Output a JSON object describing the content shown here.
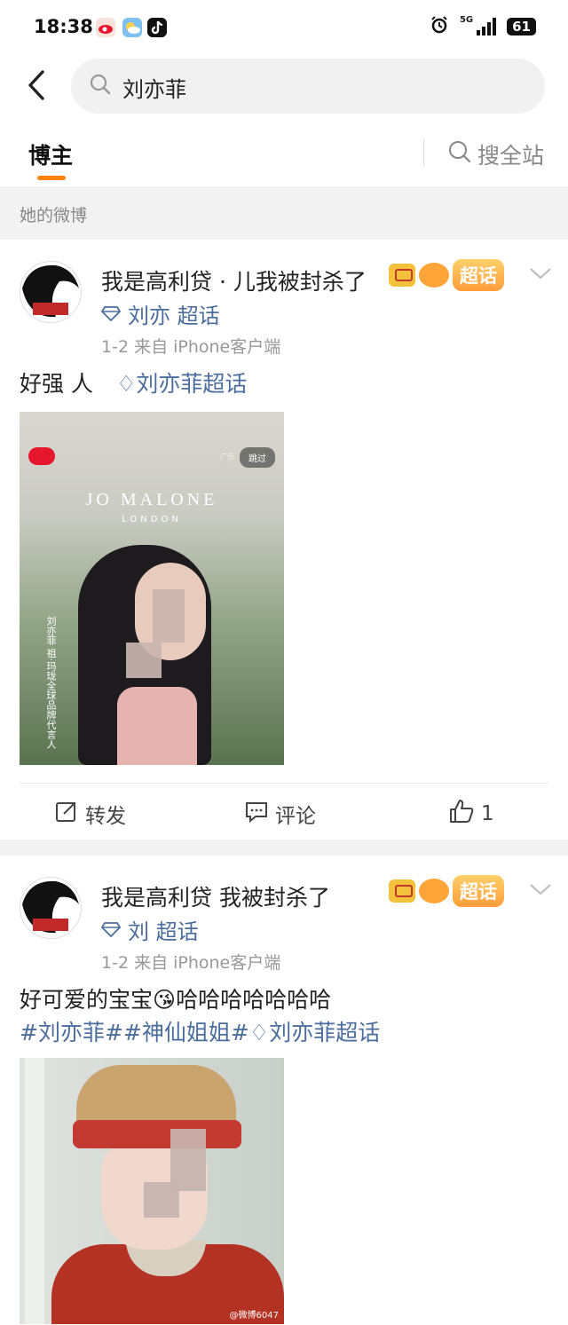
{
  "status_bar": {
    "time": "18:38",
    "network": "5G",
    "battery": "61"
  },
  "search": {
    "query": "刘亦菲"
  },
  "tabs": {
    "active": "博主",
    "search_all": "搜全站"
  },
  "section_label": "她的微博",
  "posts": [
    {
      "username": "我是高利贷   ·  儿我被封杀了",
      "badge": "超话",
      "tag": "刘亦   超话",
      "meta": "1-2   来自 iPhone客户端",
      "text": "好强    人",
      "link": "刘亦菲超话",
      "image": {
        "brand": "JO MALONE",
        "brand_sub": "LONDON",
        "skip": "跳过",
        "ad": "广告",
        "caption": "刘亦菲 祖·玛珑全球品牌代言人"
      },
      "actions": {
        "repost": "转发",
        "comment": "评论",
        "like_count": "1"
      }
    },
    {
      "username": "我是高利贷      我被封杀了",
      "badge": "超话",
      "tag": "刘     超话",
      "meta": "1-2   来自 iPhone客户端",
      "text": "好可爱的宝宝😘哈哈哈哈哈哈哈",
      "link": "#刘亦菲##神仙姐姐#",
      "link2": "刘亦菲超话",
      "image": {
        "watermark": "@微博6047"
      }
    }
  ]
}
